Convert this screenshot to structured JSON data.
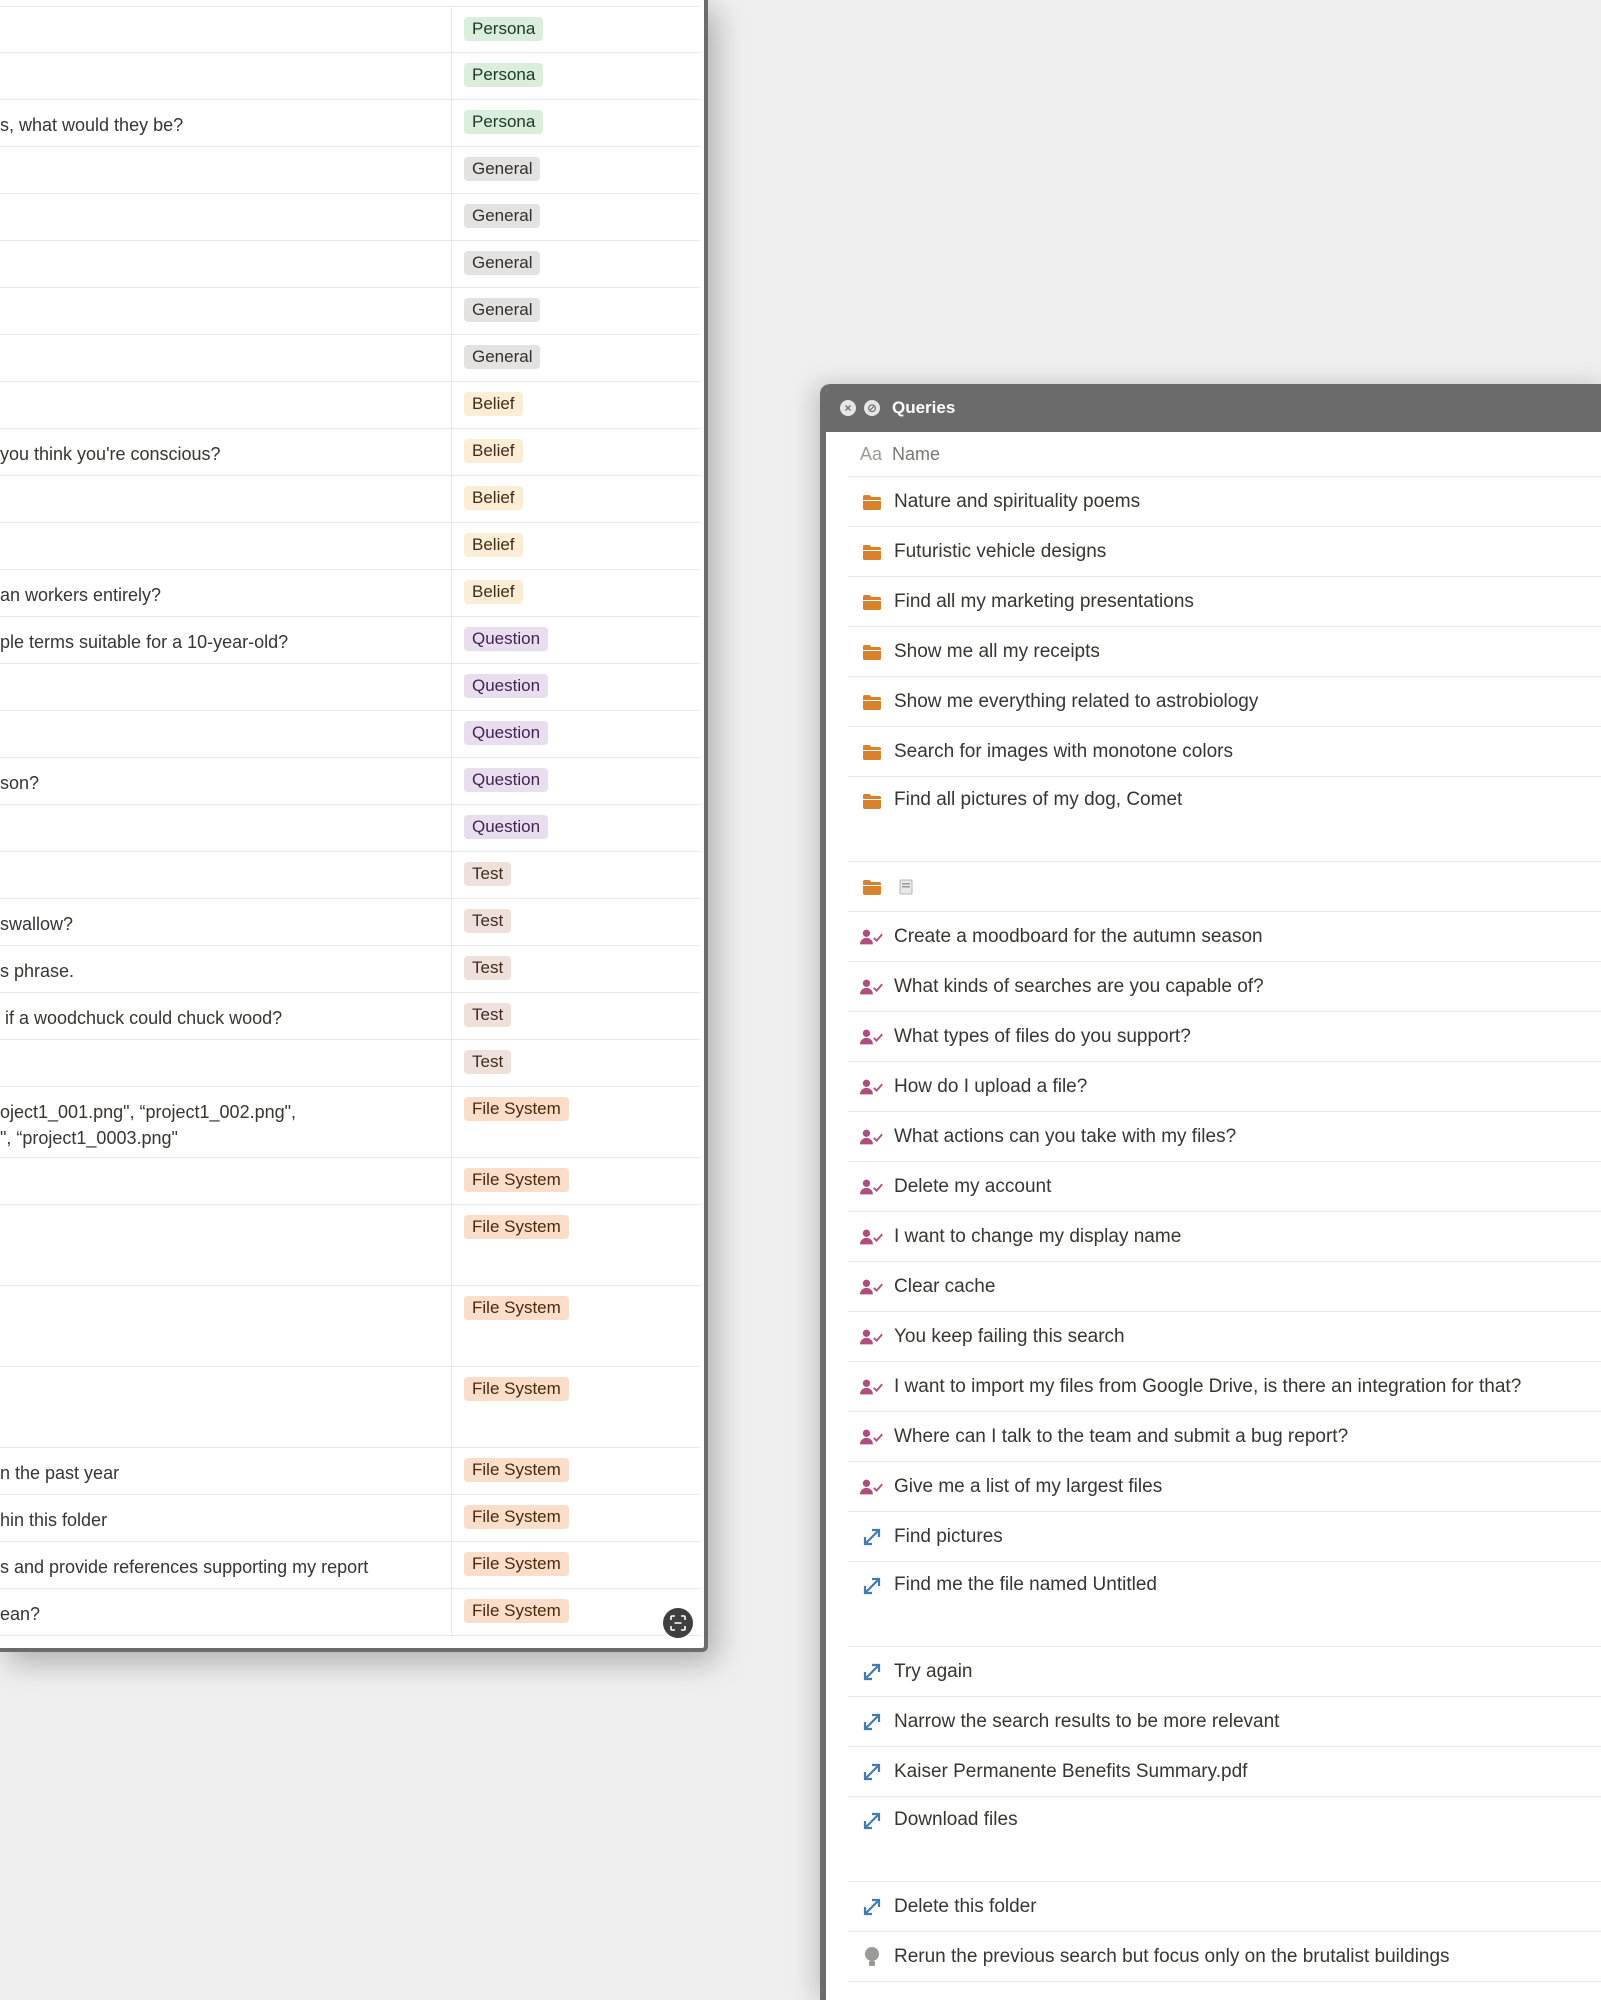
{
  "left_table": {
    "rows": [
      {
        "text": "",
        "tag": "Persona",
        "tag_class": "Persona"
      },
      {
        "text": "",
        "tag": "Persona",
        "tag_class": "Persona"
      },
      {
        "text": "s, what would they be?",
        "tag": "Persona",
        "tag_class": "Persona"
      },
      {
        "text": "",
        "tag": "General",
        "tag_class": "General"
      },
      {
        "text": "",
        "tag": "General",
        "tag_class": "General"
      },
      {
        "text": "",
        "tag": "General",
        "tag_class": "General"
      },
      {
        "text": "",
        "tag": "General",
        "tag_class": "General"
      },
      {
        "text": "",
        "tag": "General",
        "tag_class": "General"
      },
      {
        "text": "",
        "tag": "Belief",
        "tag_class": "Belief"
      },
      {
        "text": "you think you're conscious?",
        "tag": "Belief",
        "tag_class": "Belief"
      },
      {
        "text": "",
        "tag": "Belief",
        "tag_class": "Belief"
      },
      {
        "text": "",
        "tag": "Belief",
        "tag_class": "Belief"
      },
      {
        "text": "an workers entirely?",
        "tag": "Belief",
        "tag_class": "Belief"
      },
      {
        "text": "ple terms suitable for a 10-year-old?",
        "tag": "Question",
        "tag_class": "Question"
      },
      {
        "text": "",
        "tag": "Question",
        "tag_class": "Question"
      },
      {
        "text": "",
        "tag": "Question",
        "tag_class": "Question"
      },
      {
        "text": "son?",
        "tag": "Question",
        "tag_class": "Question"
      },
      {
        "text": "",
        "tag": "Question",
        "tag_class": "Question"
      },
      {
        "text": "",
        "tag": "Test",
        "tag_class": "Test"
      },
      {
        "text": "swallow?",
        "tag": "Test",
        "tag_class": "Test"
      },
      {
        "text": "s phrase.",
        "tag": "Test",
        "tag_class": "Test"
      },
      {
        "text": " if a woodchuck could chuck wood?",
        "tag": "Test",
        "tag_class": "Test"
      },
      {
        "text": "",
        "tag": "Test",
        "tag_class": "Test"
      },
      {
        "text": "oject1_001.png\", “project1_002.png\",\n\", “project1_0003.png\"",
        "tag": "File System",
        "tag_class": "File"
      },
      {
        "text": "",
        "tag": "File System",
        "tag_class": "File"
      },
      {
        "text": "",
        "tag": "File System",
        "tag_class": "File"
      },
      {
        "text": "",
        "tag": "File System",
        "tag_class": "File"
      },
      {
        "text": "",
        "tag": "File System",
        "tag_class": "File"
      },
      {
        "text": "n the past year",
        "tag": "File System",
        "tag_class": "File"
      },
      {
        "text": "hin this folder",
        "tag": "File System",
        "tag_class": "File"
      },
      {
        "text": "s and provide references supporting my report",
        "tag": "File System",
        "tag_class": "File"
      },
      {
        "text": "ean?",
        "tag": "File System",
        "tag_class": "File"
      }
    ]
  },
  "queries_window": {
    "title": "Queries",
    "column_header": "Name",
    "column_icon_text": "Aa",
    "rows": [
      {
        "icon": "folder-icon",
        "text": "Nature and spirituality poems"
      },
      {
        "icon": "folder-icon",
        "text": "Futuristic vehicle designs"
      },
      {
        "icon": "folder-icon",
        "text": "Find all my marketing presentations"
      },
      {
        "icon": "folder-icon",
        "text": "Show me all my receipts"
      },
      {
        "icon": "folder-icon",
        "text": "Show me everything related to astrobiology"
      },
      {
        "icon": "folder-icon",
        "text": "Search for images with monotone colors"
      },
      {
        "icon": "folder-icon",
        "text": "Find all pictures of my dog, Comet",
        "tall": true
      },
      {
        "icon": "folder-icon",
        "text": "",
        "extra": "document-icon"
      },
      {
        "icon": "user-check-icon",
        "text": "Create a moodboard for the autumn season"
      },
      {
        "icon": "user-check-icon",
        "text": "What kinds of searches are you capable of?"
      },
      {
        "icon": "user-check-icon",
        "text": "What types of files do you support?"
      },
      {
        "icon": "user-check-icon",
        "text": "How do I upload a file?"
      },
      {
        "icon": "user-check-icon",
        "text": "What actions can you take with my files?"
      },
      {
        "icon": "user-check-icon",
        "text": "Delete my account"
      },
      {
        "icon": "user-check-icon",
        "text": "I want to change my display name"
      },
      {
        "icon": "user-check-icon",
        "text": "Clear cache"
      },
      {
        "icon": "user-check-icon",
        "text": "You keep failing this search"
      },
      {
        "icon": "user-check-icon",
        "text": "I want to import my files from Google Drive, is there an integration for that?"
      },
      {
        "icon": "user-check-icon",
        "text": "Where can I talk to the team and submit a bug report?"
      },
      {
        "icon": "user-check-icon",
        "text": "Give me a list of my largest files"
      },
      {
        "icon": "expand-arrows-icon",
        "text": "Find pictures"
      },
      {
        "icon": "expand-arrows-icon",
        "text": "Find me the file named Untitled",
        "tall": true
      },
      {
        "icon": "expand-arrows-icon",
        "text": "Try again"
      },
      {
        "icon": "expand-arrows-icon",
        "text": "Narrow the search results to be more relevant"
      },
      {
        "icon": "expand-arrows-icon",
        "text": "Kaiser Permanente Benefits Summary.pdf"
      },
      {
        "icon": "expand-arrows-icon",
        "text": "Download files",
        "tall": true
      },
      {
        "icon": "expand-arrows-icon",
        "text": "Delete this folder"
      },
      {
        "icon": "lightbulb-icon",
        "text": "Rerun the previous search but focus only on the brutalist buildings"
      }
    ]
  },
  "colors": {
    "folder": "#d9822b",
    "user_check": "#b34c7e",
    "expand": "#3e7cb1",
    "lightbulb": "#9b9a97",
    "titlebar": "#6b6b6b"
  }
}
